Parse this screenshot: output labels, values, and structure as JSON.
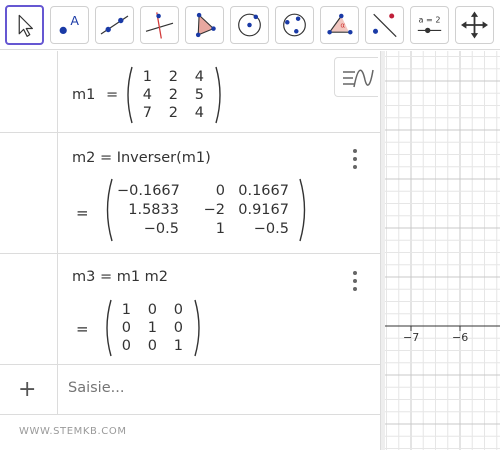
{
  "toolbar": {
    "tools": [
      {
        "name": "move",
        "icon": "cursor-arrow-icon",
        "active": true
      },
      {
        "name": "point",
        "icon": "point-icon",
        "label": "A"
      },
      {
        "name": "line",
        "icon": "line-through-two-points-icon"
      },
      {
        "name": "perpendicular-line",
        "icon": "perpendicular-line-icon"
      },
      {
        "name": "polygon",
        "icon": "polygon-icon"
      },
      {
        "name": "circle-center-point",
        "icon": "circle-center-point-icon"
      },
      {
        "name": "circle-three-points",
        "icon": "circle-three-points-icon"
      },
      {
        "name": "angle",
        "icon": "angle-icon",
        "label": "α"
      },
      {
        "name": "reflect",
        "icon": "reflect-about-line-icon"
      },
      {
        "name": "slider",
        "icon": "slider-icon",
        "label": "a = 2"
      },
      {
        "name": "move-graphics-view",
        "icon": "move-graphics-view-icon"
      }
    ],
    "accent_color": "#6557d2"
  },
  "algebra": {
    "style_toggle_icon": "algebra-style-icon",
    "m1": {
      "lhs": "m1",
      "equals": "=",
      "matrix": [
        [
          "1",
          "2",
          "4"
        ],
        [
          "4",
          "2",
          "5"
        ],
        [
          "7",
          "2",
          "4"
        ]
      ]
    },
    "m2": {
      "definition": "m2 = Inverser(m1)",
      "equals": "=",
      "matrix": [
        [
          "−0.1667",
          "0",
          "0.1667"
        ],
        [
          "1.5833",
          "−2",
          "0.9167"
        ],
        [
          "−0.5",
          "1",
          "−0.5"
        ]
      ],
      "menu_icon": "more-vertical-icon"
    },
    "m3": {
      "definition": "m3 = m1 m2",
      "equals": "=",
      "matrix": [
        [
          "1",
          "0",
          "0"
        ],
        [
          "0",
          "1",
          "0"
        ],
        [
          "0",
          "0",
          "1"
        ]
      ],
      "menu_icon": "more-vertical-icon"
    },
    "input": {
      "plus_label": "+",
      "placeholder": "Saisie..."
    }
  },
  "watermark": "WWW.STEMKB.COM",
  "graphics": {
    "x_tick_labels": [
      "−7",
      "−6"
    ]
  }
}
